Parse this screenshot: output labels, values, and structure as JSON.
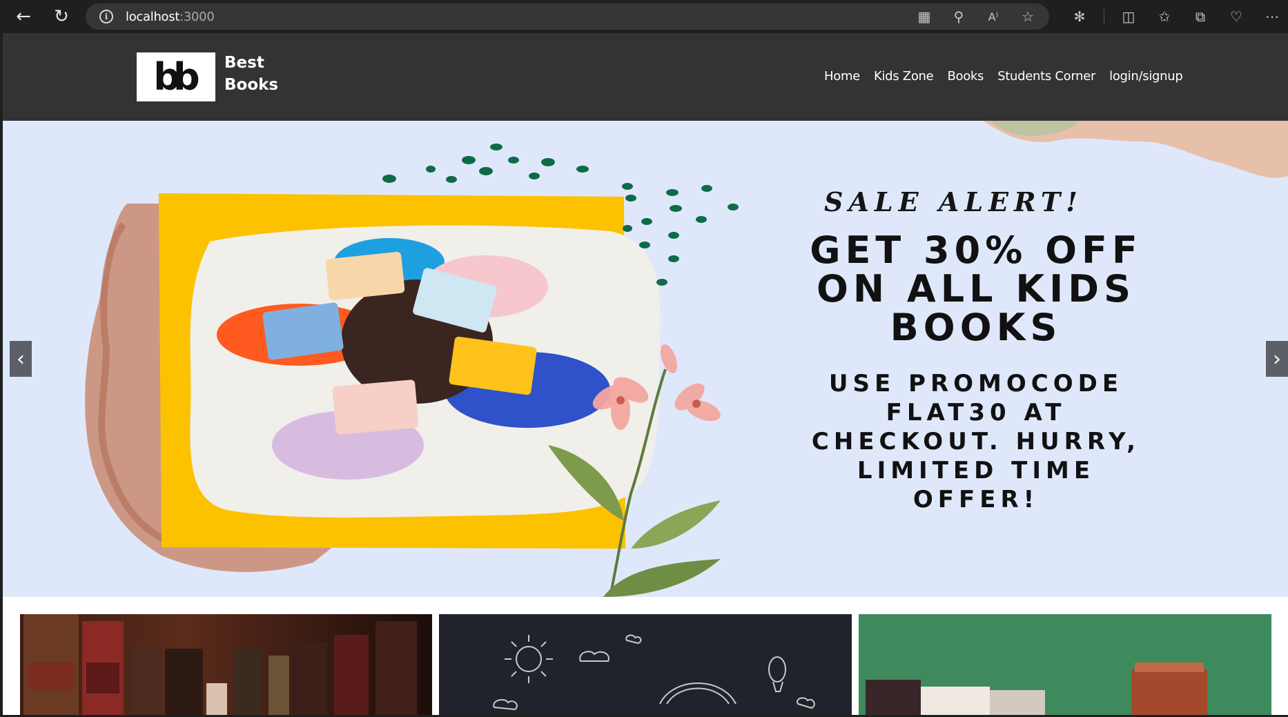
{
  "browser": {
    "url_host": "localhost",
    "url_port": ":3000",
    "icons": [
      "back-arrow-icon",
      "reload-icon",
      "info-icon",
      "apps-icon",
      "zoom-out-icon",
      "read-aloud-icon",
      "favorite-star-icon",
      "extensions-icon",
      "split-screen-icon",
      "favorites-icon",
      "collections-icon",
      "health-icon",
      "more-icon"
    ]
  },
  "site": {
    "brand_line1": "Best",
    "brand_line2": "Books",
    "logo_mark": "bb",
    "nav": [
      "Home",
      "Kids Zone",
      "Books",
      "Students Corner",
      "login/signup"
    ]
  },
  "hero": {
    "sale_alert": "SALE ALERT!",
    "promo_title_lines": [
      "GET 30% OFF",
      "ON ALL KIDS",
      "BOOKS"
    ],
    "promo_code_lines": [
      "USE PROMOCODE",
      "FLAT30 AT",
      "CHECKOUT. HURRY,",
      "LIMITED TIME",
      "OFFER!"
    ],
    "prev_label": "‹",
    "next_label": "›"
  },
  "colors": {
    "header_bg": "#333333",
    "hero_bg": "#dfe8fb",
    "yellow_frame": "#fcc200",
    "dot_green": "#0f6b47"
  }
}
